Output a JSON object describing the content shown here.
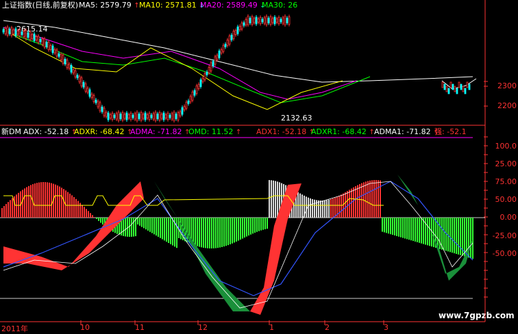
{
  "top_panel": {
    "title": "上证指数(日线,前复权)",
    "ma5": {
      "label": "MA5:",
      "value": "2579.79",
      "arrow": "↑",
      "color": "#ffffff"
    },
    "ma10": {
      "label": "MA10:",
      "value": "2571.81",
      "arrow": "↓",
      "color": "#ffff00"
    },
    "ma20": {
      "label": "MA20:",
      "value": "2589.49",
      "arrow": "↓",
      "color": "#ff00ff"
    },
    "ma30": {
      "label": "MA30:",
      "value": "26",
      "color": "#00ff00"
    },
    "high_note": "2615.14",
    "low_note": "2132.63",
    "axis_ticks": [
      "2300",
      "2200"
    ]
  },
  "bottom_panel": {
    "indicator": "新DM",
    "adx": {
      "label": "ADX:",
      "value": "-52.18",
      "arrow": "↑",
      "color": "#ffffff"
    },
    "adxr": {
      "label": "ADXR:",
      "value": "-68.42",
      "arrow": "↑",
      "color": "#ffff00"
    },
    "adma": {
      "label": "ADMA:",
      "value": "-71.82",
      "arrow": "↑",
      "color": "#ff00ff"
    },
    "omd": {
      "label": "OMD:",
      "value": "11.52",
      "arrow": "↑",
      "color": "#00ff00"
    },
    "adx1": {
      "label": "ADX1:",
      "value": "-52.18",
      "arrow": "↑",
      "color": "#ff3333"
    },
    "adxr1": {
      "label": "ADXR1:",
      "value": "-68.42",
      "arrow": "↑",
      "color": "#00ff00"
    },
    "adma1": {
      "label": "ADMA1:",
      "value": "-71.82",
      "arrow": "↑",
      "color": "#ffffff"
    },
    "strong": {
      "label": "强:",
      "value": "-52.1",
      "color": "#ff3333"
    },
    "axis_ticks": [
      "100.0",
      "75.00",
      "50.00",
      "25.00",
      "0.00",
      "-25.00",
      "-50.00"
    ]
  },
  "date_axis": {
    "labels": [
      "2011年",
      "10",
      "11",
      "12",
      "1",
      "2",
      "3"
    ]
  },
  "watermark": "www.7gpzb.com",
  "colors": {
    "up": "#ff3333",
    "down": "#00ffff",
    "hist_pos": "#dddddd",
    "hist_neg": "#33ff33",
    "grid": "#ff3333"
  }
}
